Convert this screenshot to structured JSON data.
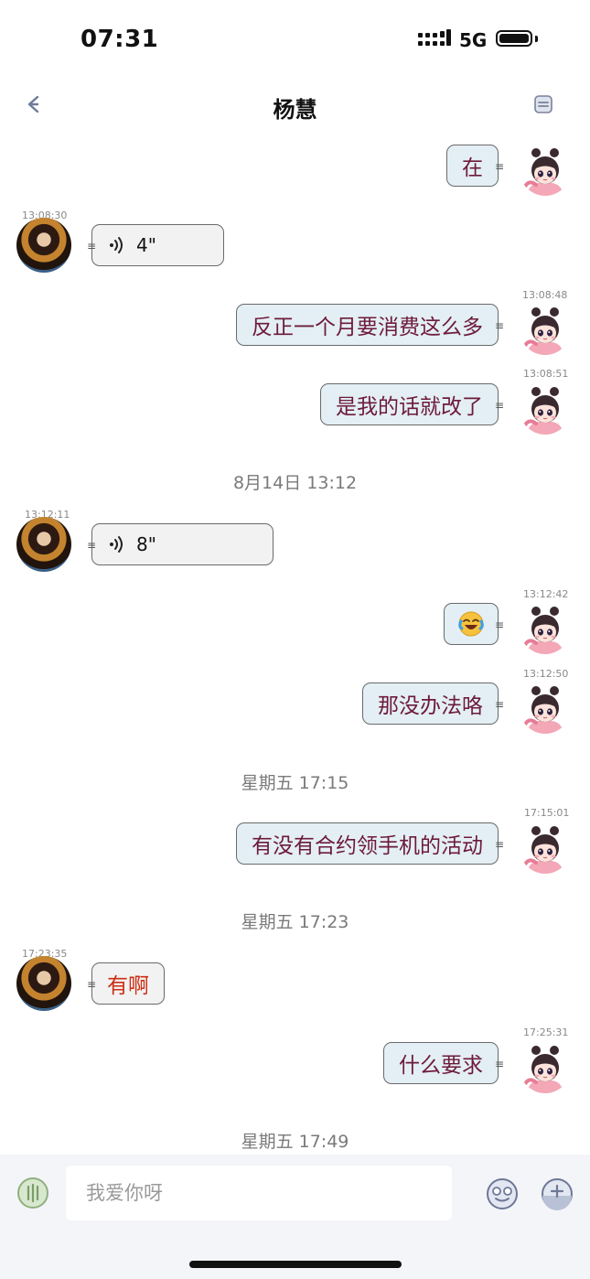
{
  "status_bar": {
    "time": "07:31",
    "network": "5G"
  },
  "header": {
    "title": "杨慧"
  },
  "messages": [
    {
      "dir": "out",
      "text": "在"
    },
    {
      "dir": "in",
      "kind": "voice",
      "time": "13:08:30",
      "duration": "4\""
    },
    {
      "dir": "out",
      "time": "13:08:48",
      "text": "反正一个月要消费这么多"
    },
    {
      "dir": "out",
      "time": "13:08:51",
      "text": "是我的话就改了"
    },
    {
      "kind": "separator",
      "text": "8月14日 13:12"
    },
    {
      "dir": "in",
      "kind": "voice",
      "time": "13:12:11",
      "duration": "8\""
    },
    {
      "dir": "out",
      "kind": "emoji",
      "time": "13:12:42",
      "emoji": "laughing-crying-emoji"
    },
    {
      "dir": "out",
      "time": "13:12:50",
      "text": "那没办法咯"
    },
    {
      "kind": "separator",
      "text": "星期五 17:15"
    },
    {
      "dir": "out",
      "time": "17:15:01",
      "text": "有没有合约领手机的活动"
    },
    {
      "kind": "separator",
      "text": "星期五 17:23"
    },
    {
      "dir": "in",
      "time": "17:23:35",
      "text": "有啊"
    },
    {
      "dir": "out",
      "time": "17:25:31",
      "text": "什么要求"
    },
    {
      "kind": "separator",
      "text": "星期五 17:49"
    }
  ],
  "input": {
    "placeholder": "我爱你呀"
  },
  "colors": {
    "outgoing_bubble": "#e3eff5",
    "outgoing_text": "#6e1a3a",
    "incoming_bubble": "#f2f2f2",
    "incoming_highlight_text": "#cc2e13"
  }
}
